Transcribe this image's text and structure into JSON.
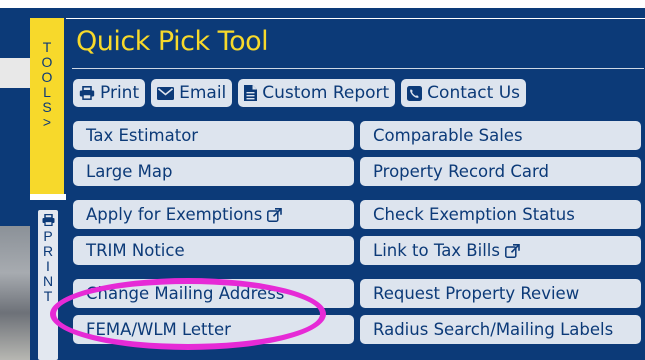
{
  "panel": {
    "title": "Quick Pick Tool"
  },
  "side_tabs": {
    "tools_letters": [
      "T",
      "O",
      "O",
      "L",
      "S",
      ">"
    ],
    "print_letters": [
      "P",
      "R",
      "I",
      "N",
      "T"
    ]
  },
  "toolbar": {
    "print_label": "Print",
    "email_label": "Email",
    "custom_report_label": "Custom Report",
    "contact_us_label": "Contact Us"
  },
  "links": {
    "tax_estimator": "Tax Estimator",
    "comparable_sales": "Comparable Sales",
    "large_map": "Large Map",
    "property_record_card": "Property Record Card",
    "apply_for_exemptions": "Apply for Exemptions",
    "check_exemption_status": "Check Exemption Status",
    "trim_notice": "TRIM Notice",
    "link_to_tax_bills": "Link to Tax Bills",
    "change_mailing_address": "Change Mailing Address",
    "request_property_review": "Request Property Review",
    "fema_wlm_letter": "FEMA/WLM Letter",
    "radius_search_mailing_labels": "Radius Search/Mailing Labels"
  },
  "colors": {
    "panel_bg": "#0c3a78",
    "title_yellow": "#f7d92b",
    "button_bg": "#dde4ee",
    "annotation_pink": "#e62ad6"
  },
  "icons": [
    "print-icon",
    "email-icon",
    "document-icon",
    "phone-icon",
    "external-link-icon"
  ]
}
